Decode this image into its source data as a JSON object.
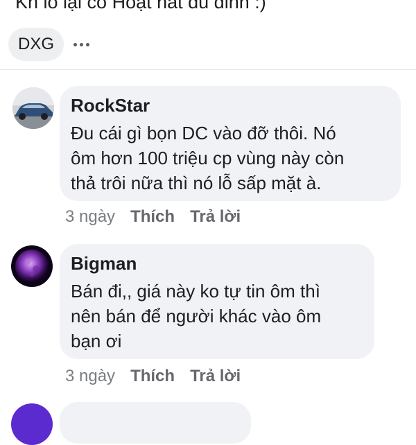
{
  "post": {
    "text_fragment": "Kh lo lại co Hoạt hat đu đinh :)"
  },
  "tag": {
    "label": "DXG",
    "more_icon": "more-horizontal-icon"
  },
  "comments": [
    {
      "author": "RockStar",
      "lines": [
        "Đu cái gì bọn DC vào đỡ thôi. Nó",
        "ôm hơn 100 triệu cp vùng này còn",
        "thả trôi nữa thì nó lỗ sấp mặt à."
      ],
      "time": "3 ngày",
      "like_label": "Thích",
      "reply_label": "Trả lời",
      "avatar_icon": "car-photo-avatar"
    },
    {
      "author": "Bigman",
      "lines": [
        "Bán đi,, giá này ko tự tin ôm thì",
        "nên bán để người khác vào ôm",
        "bạn ơi"
      ],
      "time": "3 ngày",
      "like_label": "Thích",
      "reply_label": "Trả lời",
      "avatar_icon": "purple-moon-avatar"
    }
  ],
  "colors": {
    "bubble_bg": "#f0f2f5",
    "chip_bg": "#eeeff1",
    "meta_text": "#65676b",
    "avatar_third": "#5b2bd0"
  }
}
